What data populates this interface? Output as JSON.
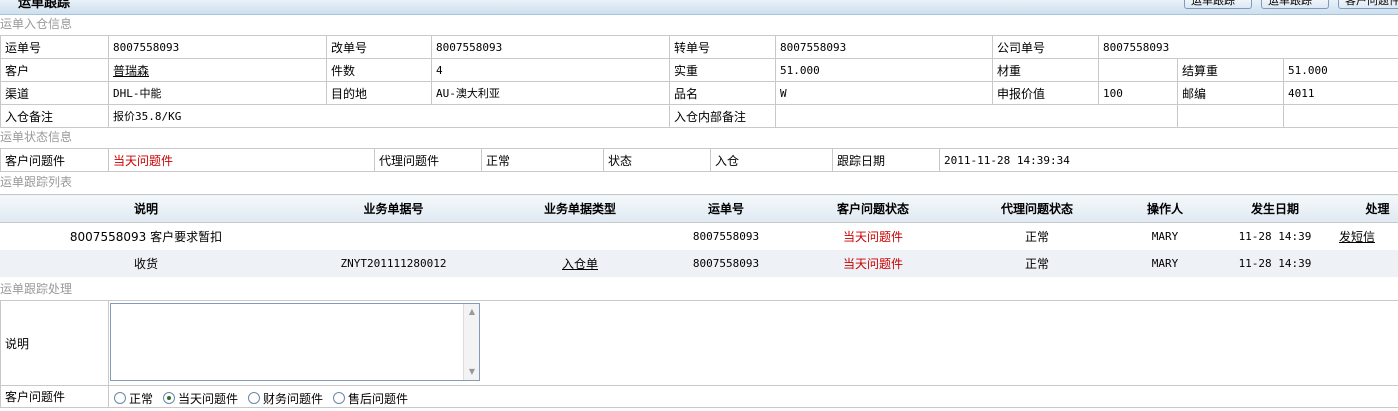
{
  "header": {
    "title": "运单跟踪",
    "buttons": [
      "运单跟踪",
      "运单跟踪",
      "客户问题件"
    ]
  },
  "sections": {
    "inbound": "运单入仓信息",
    "status": "运单状态信息",
    "tracking": "运单跟踪列表",
    "process": "运单跟踪处理"
  },
  "inbound": {
    "waybill_label": "运单号",
    "waybill": "8007558093",
    "changed_label": "改单号",
    "changed": "8007558093",
    "transfer_label": "转单号",
    "transfer": "8007558093",
    "company_label": "公司单号",
    "company": "8007558093",
    "customer_label": "客户",
    "customer": "普瑞森",
    "pieces_label": "件数",
    "pieces": "4",
    "actual_weight_label": "实重",
    "actual_weight": "51.000",
    "volume_weight_label": "材重",
    "volume_weight": "",
    "charge_weight_label": "结算重",
    "charge_weight": "51.000",
    "channel_label": "渠道",
    "channel": "DHL-中能",
    "destination_label": "目的地",
    "destination": "AU-澳大利亚",
    "product_label": "品名",
    "product": "W",
    "declared_label": "申报价值",
    "declared": "100",
    "postcode_label": "邮编",
    "postcode": "4011",
    "remark_label": "入仓备注",
    "remark": "报价35.8/KG",
    "internal_remark_label": "入仓内部备注",
    "internal_remark": ""
  },
  "status": {
    "customer_issue_label": "客户问题件",
    "customer_issue": "当天问题件",
    "agent_issue_label": "代理问题件",
    "agent_issue": "正常",
    "state_label": "状态",
    "state": "入仓",
    "track_date_label": "跟踪日期",
    "track_date": "2011-11-28 14:39:34"
  },
  "tracking": {
    "columns": [
      "说明",
      "业务单据号",
      "业务单据类型",
      "运单号",
      "客户问题状态",
      "代理问题状态",
      "操作人",
      "发生日期",
      "处理"
    ],
    "rows": [
      {
        "desc": "8007558093 客户要求暂扣",
        "doc_no": "",
        "doc_type": "",
        "waybill": "8007558093",
        "cust_status": "当天问题件",
        "agent_status": "正常",
        "operator": "MARY",
        "date": "11-28 14:39",
        "action": "发短信"
      },
      {
        "desc": "收货",
        "doc_no": "ZNYT201111280012",
        "doc_type": "入仓单",
        "waybill": "8007558093",
        "cust_status": "当天问题件",
        "agent_status": "正常",
        "operator": "MARY",
        "date": "11-28 14:39",
        "action": ""
      }
    ]
  },
  "process": {
    "desc_label": "说明",
    "desc_value": "",
    "issue_label": "客户问题件",
    "options": [
      "正常",
      "当天问题件",
      "财务问题件",
      "售后问题件"
    ],
    "selected": "当天问题件"
  }
}
